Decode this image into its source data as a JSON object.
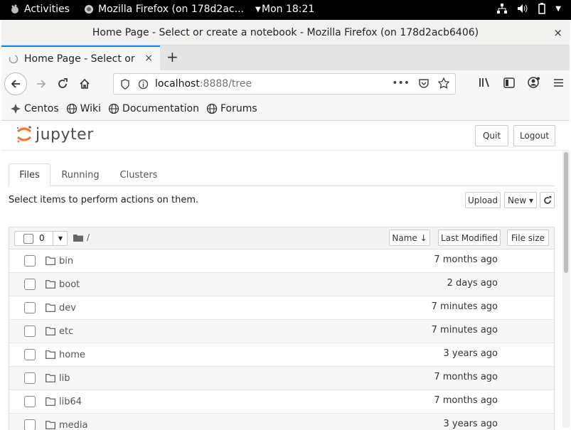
{
  "topbar": {
    "activities": "Activities",
    "app": "Mozilla Firefox (on 178d2ac...",
    "clock": "Mon 18:21"
  },
  "window": {
    "title": "Home Page - Select or create a notebook - Mozilla Firefox (on 178d2acb6406)",
    "close": "×"
  },
  "tabs": {
    "active_label": "Home Page - Select or cre",
    "close": "×",
    "new_tab": "+"
  },
  "urlbar": {
    "host": "localhost",
    "rest": ":8888/tree",
    "more": "•••"
  },
  "bookmarks": [
    "Centos",
    "Wiki",
    "Documentation",
    "Forums"
  ],
  "jupyter": {
    "logo_text": "jupyter",
    "quit": "Quit",
    "logout": "Logout",
    "tabs": [
      "Files",
      "Running",
      "Clusters"
    ],
    "hint": "Select items to perform actions on them.",
    "upload": "Upload",
    "new": "New ▾",
    "selected_count": "0",
    "breadcrumb": "/",
    "col_name": "Name ↓",
    "col_modified": "Last Modified",
    "col_size": "File size",
    "files": [
      {
        "name": "bin",
        "modified": "7 months ago"
      },
      {
        "name": "boot",
        "modified": "2 days ago"
      },
      {
        "name": "dev",
        "modified": "7 minutes ago"
      },
      {
        "name": "etc",
        "modified": "7 minutes ago"
      },
      {
        "name": "home",
        "modified": "3 years ago"
      },
      {
        "name": "lib",
        "modified": "7 months ago"
      },
      {
        "name": "lib64",
        "modified": "7 months ago"
      },
      {
        "name": "media",
        "modified": "3 years ago"
      }
    ]
  },
  "colors": {
    "accent": "#0a84ff",
    "topbar": "#000000"
  }
}
